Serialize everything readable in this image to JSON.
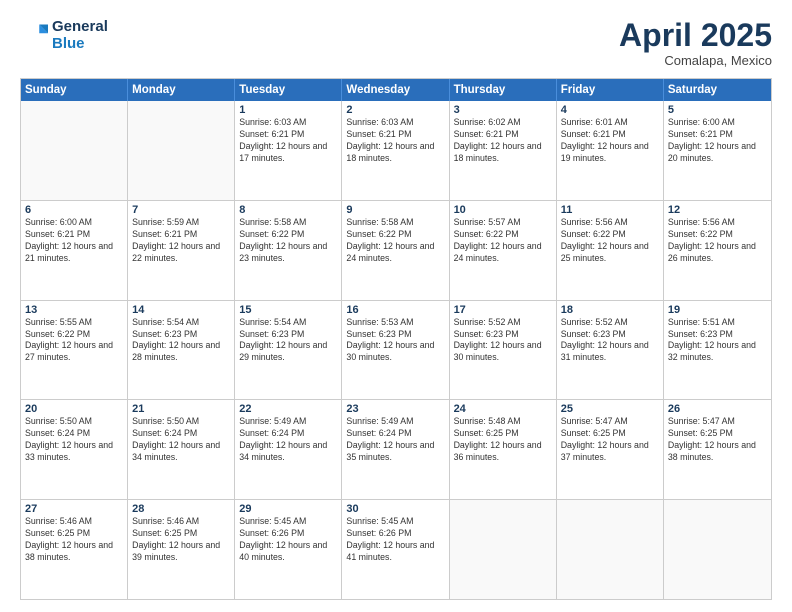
{
  "header": {
    "logo_line1": "General",
    "logo_line2": "Blue",
    "month": "April 2025",
    "location": "Comalapa, Mexico"
  },
  "days_of_week": [
    "Sunday",
    "Monday",
    "Tuesday",
    "Wednesday",
    "Thursday",
    "Friday",
    "Saturday"
  ],
  "weeks": [
    [
      {
        "day": "",
        "sunrise": "",
        "sunset": "",
        "daylight": ""
      },
      {
        "day": "",
        "sunrise": "",
        "sunset": "",
        "daylight": ""
      },
      {
        "day": "1",
        "sunrise": "Sunrise: 6:03 AM",
        "sunset": "Sunset: 6:21 PM",
        "daylight": "Daylight: 12 hours and 17 minutes."
      },
      {
        "day": "2",
        "sunrise": "Sunrise: 6:03 AM",
        "sunset": "Sunset: 6:21 PM",
        "daylight": "Daylight: 12 hours and 18 minutes."
      },
      {
        "day": "3",
        "sunrise": "Sunrise: 6:02 AM",
        "sunset": "Sunset: 6:21 PM",
        "daylight": "Daylight: 12 hours and 18 minutes."
      },
      {
        "day": "4",
        "sunrise": "Sunrise: 6:01 AM",
        "sunset": "Sunset: 6:21 PM",
        "daylight": "Daylight: 12 hours and 19 minutes."
      },
      {
        "day": "5",
        "sunrise": "Sunrise: 6:00 AM",
        "sunset": "Sunset: 6:21 PM",
        "daylight": "Daylight: 12 hours and 20 minutes."
      }
    ],
    [
      {
        "day": "6",
        "sunrise": "Sunrise: 6:00 AM",
        "sunset": "Sunset: 6:21 PM",
        "daylight": "Daylight: 12 hours and 21 minutes."
      },
      {
        "day": "7",
        "sunrise": "Sunrise: 5:59 AM",
        "sunset": "Sunset: 6:21 PM",
        "daylight": "Daylight: 12 hours and 22 minutes."
      },
      {
        "day": "8",
        "sunrise": "Sunrise: 5:58 AM",
        "sunset": "Sunset: 6:22 PM",
        "daylight": "Daylight: 12 hours and 23 minutes."
      },
      {
        "day": "9",
        "sunrise": "Sunrise: 5:58 AM",
        "sunset": "Sunset: 6:22 PM",
        "daylight": "Daylight: 12 hours and 24 minutes."
      },
      {
        "day": "10",
        "sunrise": "Sunrise: 5:57 AM",
        "sunset": "Sunset: 6:22 PM",
        "daylight": "Daylight: 12 hours and 24 minutes."
      },
      {
        "day": "11",
        "sunrise": "Sunrise: 5:56 AM",
        "sunset": "Sunset: 6:22 PM",
        "daylight": "Daylight: 12 hours and 25 minutes."
      },
      {
        "day": "12",
        "sunrise": "Sunrise: 5:56 AM",
        "sunset": "Sunset: 6:22 PM",
        "daylight": "Daylight: 12 hours and 26 minutes."
      }
    ],
    [
      {
        "day": "13",
        "sunrise": "Sunrise: 5:55 AM",
        "sunset": "Sunset: 6:22 PM",
        "daylight": "Daylight: 12 hours and 27 minutes."
      },
      {
        "day": "14",
        "sunrise": "Sunrise: 5:54 AM",
        "sunset": "Sunset: 6:23 PM",
        "daylight": "Daylight: 12 hours and 28 minutes."
      },
      {
        "day": "15",
        "sunrise": "Sunrise: 5:54 AM",
        "sunset": "Sunset: 6:23 PM",
        "daylight": "Daylight: 12 hours and 29 minutes."
      },
      {
        "day": "16",
        "sunrise": "Sunrise: 5:53 AM",
        "sunset": "Sunset: 6:23 PM",
        "daylight": "Daylight: 12 hours and 30 minutes."
      },
      {
        "day": "17",
        "sunrise": "Sunrise: 5:52 AM",
        "sunset": "Sunset: 6:23 PM",
        "daylight": "Daylight: 12 hours and 30 minutes."
      },
      {
        "day": "18",
        "sunrise": "Sunrise: 5:52 AM",
        "sunset": "Sunset: 6:23 PM",
        "daylight": "Daylight: 12 hours and 31 minutes."
      },
      {
        "day": "19",
        "sunrise": "Sunrise: 5:51 AM",
        "sunset": "Sunset: 6:23 PM",
        "daylight": "Daylight: 12 hours and 32 minutes."
      }
    ],
    [
      {
        "day": "20",
        "sunrise": "Sunrise: 5:50 AM",
        "sunset": "Sunset: 6:24 PM",
        "daylight": "Daylight: 12 hours and 33 minutes."
      },
      {
        "day": "21",
        "sunrise": "Sunrise: 5:50 AM",
        "sunset": "Sunset: 6:24 PM",
        "daylight": "Daylight: 12 hours and 34 minutes."
      },
      {
        "day": "22",
        "sunrise": "Sunrise: 5:49 AM",
        "sunset": "Sunset: 6:24 PM",
        "daylight": "Daylight: 12 hours and 34 minutes."
      },
      {
        "day": "23",
        "sunrise": "Sunrise: 5:49 AM",
        "sunset": "Sunset: 6:24 PM",
        "daylight": "Daylight: 12 hours and 35 minutes."
      },
      {
        "day": "24",
        "sunrise": "Sunrise: 5:48 AM",
        "sunset": "Sunset: 6:25 PM",
        "daylight": "Daylight: 12 hours and 36 minutes."
      },
      {
        "day": "25",
        "sunrise": "Sunrise: 5:47 AM",
        "sunset": "Sunset: 6:25 PM",
        "daylight": "Daylight: 12 hours and 37 minutes."
      },
      {
        "day": "26",
        "sunrise": "Sunrise: 5:47 AM",
        "sunset": "Sunset: 6:25 PM",
        "daylight": "Daylight: 12 hours and 38 minutes."
      }
    ],
    [
      {
        "day": "27",
        "sunrise": "Sunrise: 5:46 AM",
        "sunset": "Sunset: 6:25 PM",
        "daylight": "Daylight: 12 hours and 38 minutes."
      },
      {
        "day": "28",
        "sunrise": "Sunrise: 5:46 AM",
        "sunset": "Sunset: 6:25 PM",
        "daylight": "Daylight: 12 hours and 39 minutes."
      },
      {
        "day": "29",
        "sunrise": "Sunrise: 5:45 AM",
        "sunset": "Sunset: 6:26 PM",
        "daylight": "Daylight: 12 hours and 40 minutes."
      },
      {
        "day": "30",
        "sunrise": "Sunrise: 5:45 AM",
        "sunset": "Sunset: 6:26 PM",
        "daylight": "Daylight: 12 hours and 41 minutes."
      },
      {
        "day": "",
        "sunrise": "",
        "sunset": "",
        "daylight": ""
      },
      {
        "day": "",
        "sunrise": "",
        "sunset": "",
        "daylight": ""
      },
      {
        "day": "",
        "sunrise": "",
        "sunset": "",
        "daylight": ""
      }
    ]
  ]
}
